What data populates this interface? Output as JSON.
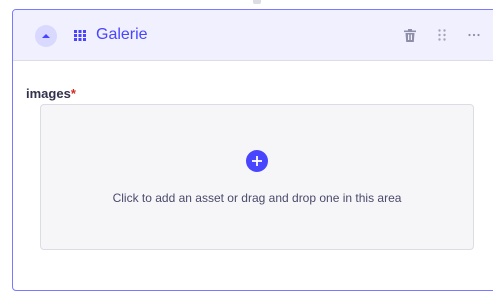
{
  "component": {
    "title": "Galerie"
  },
  "field": {
    "label": "images",
    "required_mark": "*"
  },
  "dropzone": {
    "text": "Click to add an asset or drag and drop one in this area"
  },
  "colors": {
    "accent": "#4945ff",
    "header_bg": "#f0f0ff",
    "border_accent": "#7b79ff",
    "required": "#d02b20",
    "dropzone_bg": "#f6f6f9"
  },
  "icons": {
    "collapse": "chevron-up-icon",
    "component": "grid-icon",
    "delete": "trash-icon",
    "drag": "drag-handle-icon",
    "more": "more-icon",
    "add": "plus-icon"
  }
}
